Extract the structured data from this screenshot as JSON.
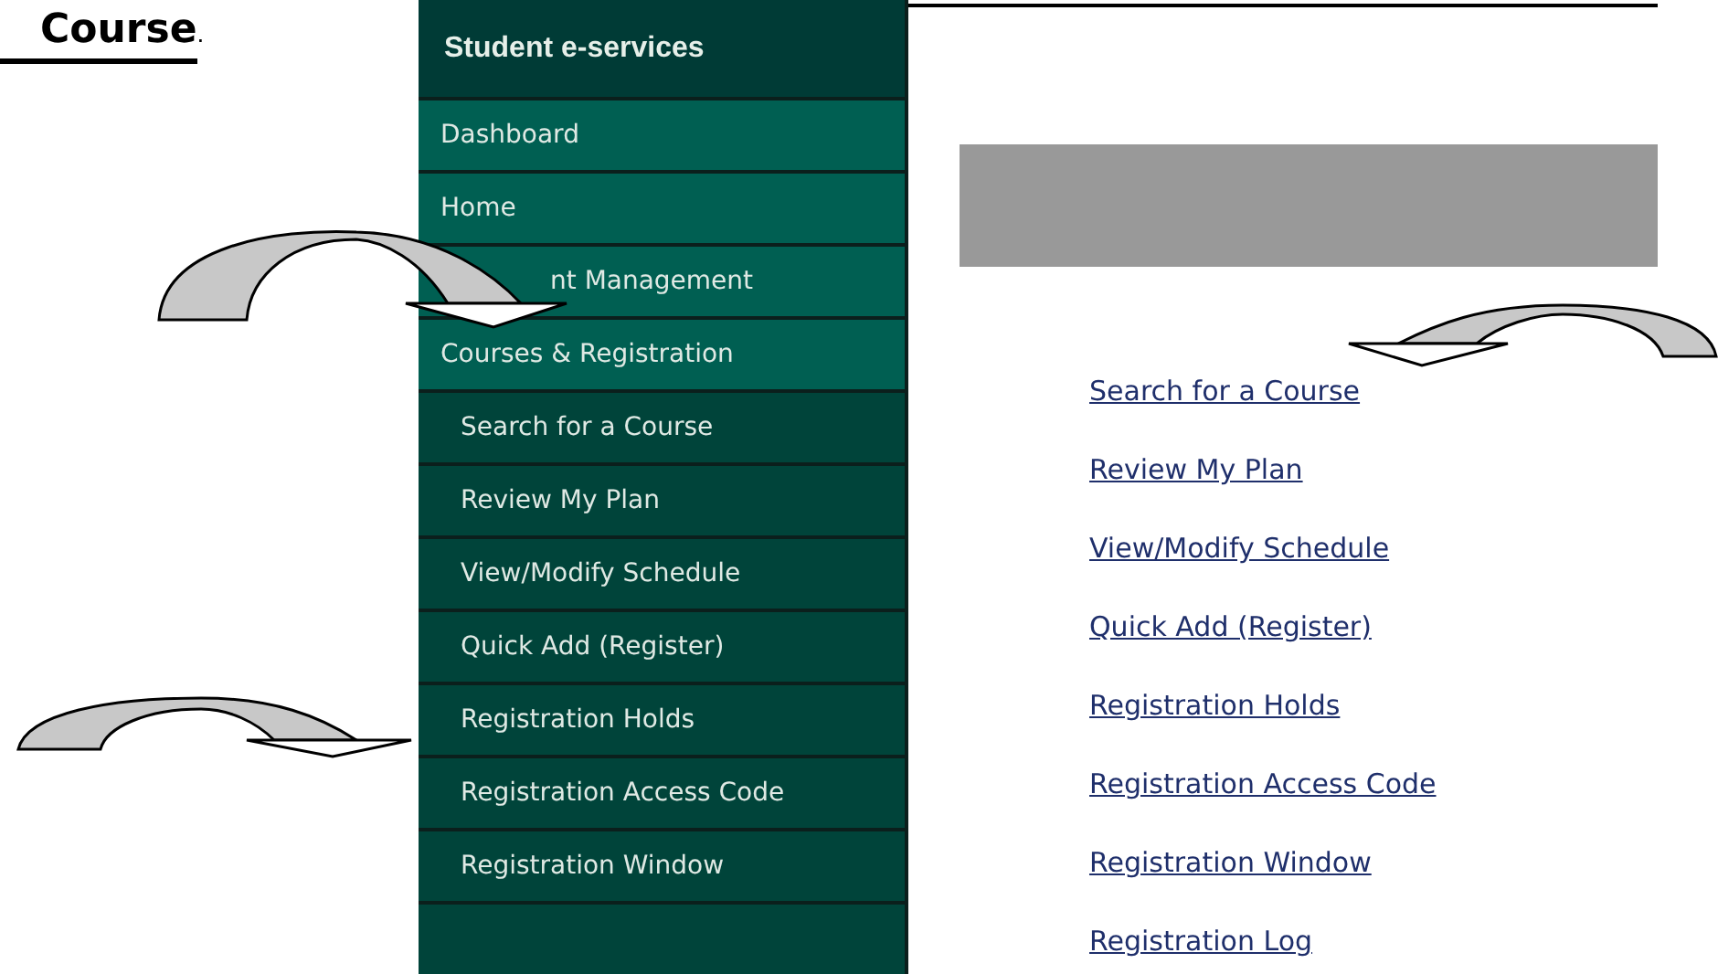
{
  "heading": {
    "text": "Course",
    "trailing": "."
  },
  "sidebar": {
    "title": "Student e-services",
    "items": [
      {
        "label": "Dashboard",
        "kind": "section"
      },
      {
        "label": "Home",
        "kind": "section"
      },
      {
        "label": "nt Management",
        "kind": "section"
      },
      {
        "label": "Courses & Registration",
        "kind": "section"
      },
      {
        "label": "Search for a Course",
        "kind": "sub"
      },
      {
        "label": "Review My Plan",
        "kind": "sub"
      },
      {
        "label": "View/Modify Schedule",
        "kind": "sub"
      },
      {
        "label": "Quick Add (Register)",
        "kind": "sub"
      },
      {
        "label": "Registration Holds",
        "kind": "sub"
      },
      {
        "label": "Registration Access Code",
        "kind": "sub"
      },
      {
        "label": "Registration Window",
        "kind": "sub"
      }
    ]
  },
  "links": [
    "Search for a Course",
    "Review My Plan",
    "View/Modify Schedule",
    "Quick Add (Register)",
    "Registration Holds",
    "Registration Access Code",
    "Registration Window",
    "Registration Log"
  ]
}
